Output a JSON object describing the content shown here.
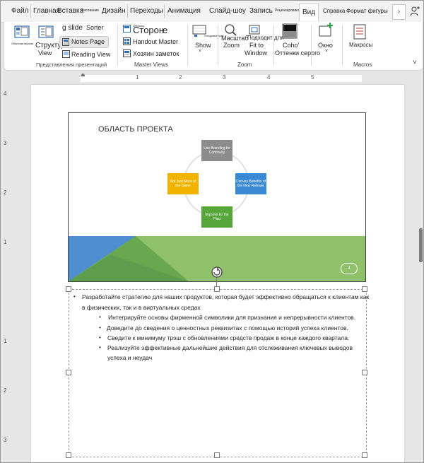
{
  "tabs": {
    "file": "Файл",
    "home": "Главная",
    "insert": "Вставка",
    "draw": "Рисование",
    "design": "Дизайн",
    "transitions": "Переходы",
    "animations": "Анимация",
    "slideshow": "Слайд-шоу",
    "record": "Запись",
    "review": "Рецензирование",
    "view": "Вид",
    "help": "Справка",
    "shape_format": "Формат фигуры",
    "more": "›"
  },
  "ribbon": {
    "normal": "Обычная версия",
    "outline_1": "Структура",
    "outline_2": "View",
    "slide_sorter_1": "g slide",
    "slide_sorter_2": "Sorter",
    "notes_page": "Notes Page",
    "reading_view": "Reading View",
    "group_presentation_views": "Представления презентаций",
    "slide_master_1": "Образец",
    "slide_master_2": "Сторон",
    "slide_master_3": "е",
    "handout_master": "Handout Master",
    "notes_master": "Хозяин заметок",
    "group_master_views": "Master Views",
    "show": "Show",
    "show_top": "Ноходимые поля",
    "zoom_1": "Масштаб",
    "zoom_2": "Zoom",
    "fit_1": "Подходит для",
    "fit_2": "Fit to",
    "fit_3": "Window",
    "group_zoom": "Zoom",
    "grayscale_1": "Coho'",
    "grayscale_2": "Оттенки серого",
    "window": "Окно",
    "macros": "Макросы",
    "group_macros": "Macros"
  },
  "ruler": {
    "h_ticks": [
      "1",
      "2",
      "3",
      "4",
      "5"
    ],
    "v_ticks": [
      "4",
      "3",
      "2",
      "1",
      "1",
      "2",
      "3"
    ]
  },
  "slide": {
    "title": "ОБЛАСТЬ ПРОЕКТА",
    "nodes": {
      "top": "Use Branding for Continuity",
      "right": "Convey Benefits of the New Release",
      "bottom": "Improve on the Past",
      "left": "Not Just More of the Same"
    },
    "number": "4"
  },
  "notes": {
    "line1": "Разработайте стратегию для наших продуктов, которая будет эффективно обращаться к клиентам как",
    "line2": "в физических, так и в виртуальных средах",
    "b1": "Интегрируйте основы фирменной символики для признания и непрерывности клиентов.",
    "b2": "Доведите до сведения о ценностных реквизитах с помощью историй успеха клиентов.",
    "b3": "Сведите к минимуму трэш с обновлениями средств продаж в конце каждого квартала.",
    "b4a": "Реализуйте эффективные дальнейшие действия для отслеживания ключевых выводов",
    "b4b": "успеха и неудач"
  },
  "colors": {
    "node_gray": "#8c8c8c",
    "node_blue": "#3a89d4",
    "node_green": "#57a63a",
    "node_yellow": "#f0b400",
    "band_green": "#8fc16b",
    "band_blue": "#4f8fd0"
  }
}
